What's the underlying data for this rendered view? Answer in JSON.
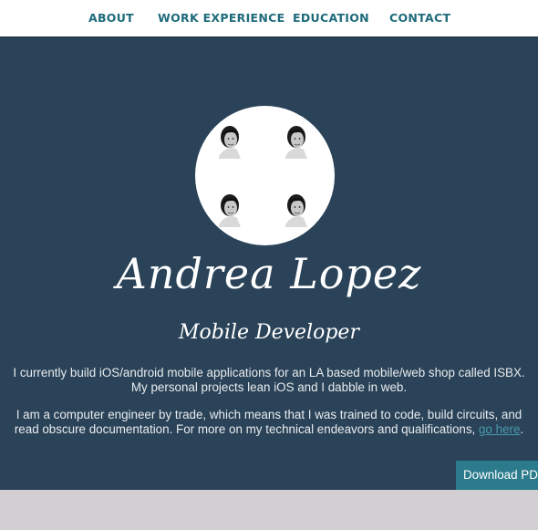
{
  "nav": {
    "items": [
      {
        "label": "ABOUT"
      },
      {
        "label": "WORK EXPERIENCE"
      },
      {
        "label": "EDUCATION"
      },
      {
        "label": "CONTACT"
      }
    ]
  },
  "hero": {
    "name": "Andrea Lopez",
    "role": "Mobile Developer",
    "bio": {
      "line1": "I currently build iOS/android mobile applications for an LA based mobile/web shop called ISBX.",
      "line2": "My personal projects lean iOS and I dabble in web.",
      "line3": "I am a computer engineer by trade, which means that I was trained to code, build circuits, and",
      "line4_text": "read obscure documentation. For more on my technical endeavors and qualifications, ",
      "link_label": "go here",
      "line4_end": "."
    },
    "download_label": "Download PDF"
  },
  "colors": {
    "hero_bg": "#2a4358",
    "nav_text": "#1e6b7b",
    "link": "#4a9aae",
    "button_bg": "#2b7b8c",
    "page_bottom": "#d3ced2"
  }
}
